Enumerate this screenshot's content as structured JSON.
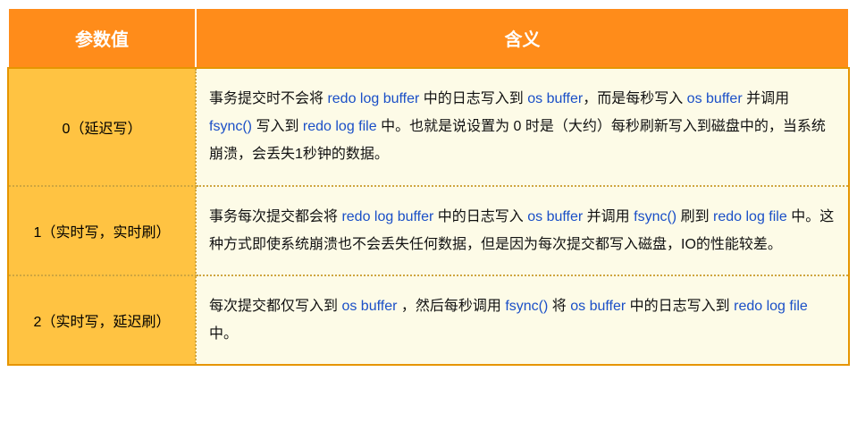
{
  "headers": {
    "param": "参数值",
    "meaning": "含义"
  },
  "terms": {
    "redo_log_buffer": "redo log buffer",
    "os_buffer": "os buffer",
    "fsync": "fsync()",
    "redo_log_file": "redo log file"
  },
  "rows": [
    {
      "param": "0（延迟写）",
      "desc": {
        "p1a": "事务提交时不会将 ",
        "p1b": " 中的日志写入到 ",
        "p1c": "，而是每秒写入 ",
        "p1d": " 并调用 ",
        "p1e": " 写入到 ",
        "p1f": " 中。也就是说设置为 0 时是（大约）每秒刷新写入到磁盘中的，当系统崩溃，会丢失1秒钟的数据。"
      }
    },
    {
      "param": "1（实时写，实时刷）",
      "desc": {
        "p2a": "事务每次提交都会将 ",
        "p2b": " 中的日志写入 ",
        "p2c": " 并调用 ",
        "p2d": " 刷到 ",
        "p2e": " 中。这种方式即使系统崩溃也不会丢失任何数据，但是因为每次提交都写入磁盘，IO的性能较差。"
      }
    },
    {
      "param": "2（实时写，延迟刷）",
      "desc": {
        "p3a": "每次提交都仅写入到 ",
        "p3b": " ，然后每秒调用 ",
        "p3c": " 将 ",
        "p3d": " 中的日志写入到 ",
        "p3e": " 中。"
      }
    }
  ]
}
